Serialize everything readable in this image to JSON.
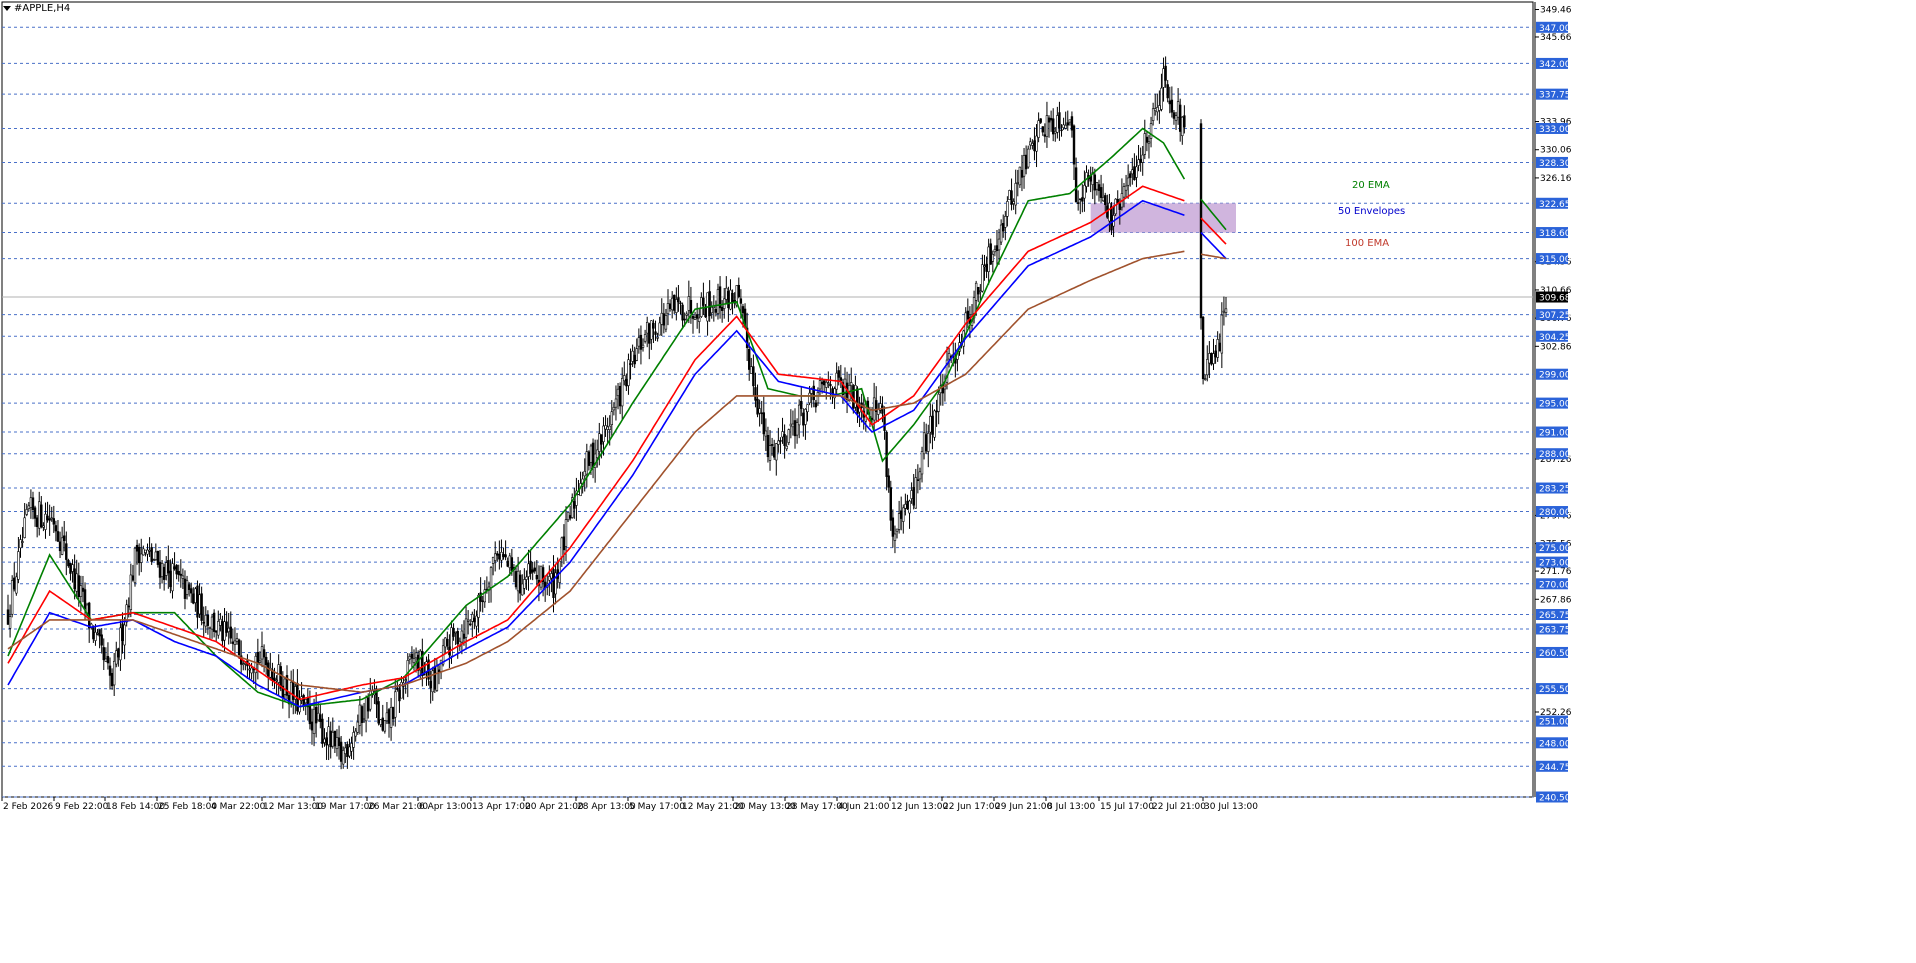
{
  "window": {
    "title": "#APPLE,H4"
  },
  "chart_data": {
    "type": "candlestick",
    "symbol": "#APPLE",
    "timeframe": "H4",
    "current_price": 309.68,
    "ylim": [
      240.5,
      350.5
    ],
    "price_scale_labels": [
      349.46,
      345.66,
      333.96,
      330.06,
      326.16,
      314.56,
      310.66,
      306.76,
      302.86,
      287.26,
      279.46,
      275.56,
      271.76,
      267.86,
      252.26
    ],
    "levels": [
      347.0,
      342.0,
      337.75,
      333.0,
      328.3,
      322.65,
      318.6,
      315.0,
      307.25,
      304.25,
      299.0,
      295.0,
      291.0,
      288.0,
      283.25,
      280.0,
      275.0,
      273.0,
      270.0,
      265.75,
      263.75,
      260.5,
      255.5,
      251.0,
      248.0,
      244.75,
      240.5
    ],
    "level_label_text": [
      "347.00",
      "342.00",
      "337.75",
      "333.00",
      "328.30",
      "322.65",
      "318.60",
      "315.00",
      "307.25",
      "304.25",
      "299.00",
      "295.00",
      "291.00",
      "288.00",
      "283.25",
      "280.00",
      "275.00",
      "273.00",
      "270.00",
      "265.75",
      "263.75",
      "260.50",
      "255.50",
      "251.00",
      "248.00",
      "244.75",
      "240.50"
    ],
    "x_labels": [
      "2 Feb 2026",
      "9 Feb 22:00",
      "18 Feb 14:00",
      "25 Feb 18:00",
      "4 Mar 22:00",
      "12 Mar 13:00",
      "19 Mar 17:00",
      "26 Mar 21:00",
      "6 Apr 13:00",
      "13 Apr 17:00",
      "20 Apr 21:00",
      "28 Apr 13:00",
      "5 May 17:00",
      "12 May 21:00",
      "20 May 13:00",
      "28 May 17:00",
      "4 Jun 21:00",
      "12 Jun 13:00",
      "22 Jun 17:00",
      "29 Jun 21:00",
      "8 Jul 13:00",
      "15 Jul 17:00",
      "22 Jul 21:00",
      "30 Jul 13:00"
    ],
    "anchors": [
      [
        0,
        266
      ],
      [
        10,
        280
      ],
      [
        22,
        279
      ],
      [
        40,
        264
      ],
      [
        50,
        256
      ],
      [
        62,
        275
      ],
      [
        80,
        271
      ],
      [
        100,
        264
      ],
      [
        110,
        261
      ],
      [
        125,
        259
      ],
      [
        135,
        255
      ],
      [
        150,
        250
      ],
      [
        160,
        246
      ],
      [
        175,
        255
      ],
      [
        180,
        249
      ],
      [
        195,
        260
      ],
      [
        205,
        256
      ],
      [
        210,
        261
      ],
      [
        225,
        266
      ],
      [
        235,
        275
      ],
      [
        245,
        270
      ],
      [
        250,
        271
      ],
      [
        262,
        270
      ],
      [
        275,
        285
      ],
      [
        285,
        290
      ],
      [
        305,
        304
      ],
      [
        320,
        308
      ],
      [
        340,
        309
      ],
      [
        350,
        310
      ],
      [
        365,
        288
      ],
      [
        380,
        293
      ],
      [
        395,
        298
      ],
      [
        410,
        295
      ],
      [
        420,
        294
      ],
      [
        425,
        276
      ],
      [
        435,
        282
      ],
      [
        440,
        289
      ],
      [
        452,
        300
      ],
      [
        465,
        310
      ],
      [
        480,
        322
      ],
      [
        495,
        333
      ],
      [
        510,
        335
      ],
      [
        513,
        324
      ],
      [
        520,
        326
      ],
      [
        525,
        325
      ],
      [
        530,
        320
      ],
      [
        545,
        330
      ],
      [
        555,
        340
      ],
      [
        563,
        334
      ],
      [
        570,
        326
      ],
      [
        574,
        299
      ],
      [
        580,
        301
      ],
      [
        585,
        308
      ]
    ],
    "series": [
      {
        "name": "20 EMA",
        "color": "#008000",
        "anchors": [
          [
            0,
            260
          ],
          [
            20,
            274
          ],
          [
            40,
            265
          ],
          [
            60,
            266
          ],
          [
            80,
            266
          ],
          [
            100,
            260
          ],
          [
            120,
            255
          ],
          [
            140,
            253
          ],
          [
            170,
            254
          ],
          [
            190,
            257
          ],
          [
            220,
            267
          ],
          [
            240,
            271
          ],
          [
            270,
            281
          ],
          [
            300,
            295
          ],
          [
            330,
            308
          ],
          [
            350,
            309
          ],
          [
            365,
            297
          ],
          [
            380,
            296
          ],
          [
            395,
            296
          ],
          [
            410,
            297
          ],
          [
            420,
            287
          ],
          [
            435,
            292
          ],
          [
            450,
            298
          ],
          [
            470,
            311
          ],
          [
            490,
            323
          ],
          [
            510,
            324
          ],
          [
            530,
            329
          ],
          [
            545,
            333
          ],
          [
            555,
            331
          ],
          [
            565,
            326
          ],
          [
            585,
            319
          ]
        ]
      },
      {
        "name": "red envelope",
        "color": "#ff0000",
        "anchors": [
          [
            0,
            259
          ],
          [
            20,
            269
          ],
          [
            40,
            265
          ],
          [
            60,
            266
          ],
          [
            80,
            264
          ],
          [
            100,
            262
          ],
          [
            120,
            258
          ],
          [
            140,
            254
          ],
          [
            170,
            256
          ],
          [
            190,
            257
          ],
          [
            220,
            262
          ],
          [
            240,
            265
          ],
          [
            270,
            275
          ],
          [
            300,
            287
          ],
          [
            330,
            301
          ],
          [
            350,
            307
          ],
          [
            370,
            299
          ],
          [
            400,
            298
          ],
          [
            415,
            292
          ],
          [
            435,
            296
          ],
          [
            460,
            306
          ],
          [
            490,
            316
          ],
          [
            520,
            320
          ],
          [
            545,
            325
          ],
          [
            565,
            323
          ],
          [
            585,
            317
          ]
        ]
      },
      {
        "name": "blue envelope",
        "color": "#0000ff",
        "anchors": [
          [
            0,
            256
          ],
          [
            20,
            266
          ],
          [
            40,
            264
          ],
          [
            60,
            265
          ],
          [
            80,
            262
          ],
          [
            100,
            260
          ],
          [
            120,
            256
          ],
          [
            140,
            253
          ],
          [
            170,
            255
          ],
          [
            190,
            256
          ],
          [
            220,
            261
          ],
          [
            240,
            264
          ],
          [
            270,
            273
          ],
          [
            300,
            285
          ],
          [
            330,
            299
          ],
          [
            350,
            305
          ],
          [
            370,
            298
          ],
          [
            400,
            296
          ],
          [
            415,
            291
          ],
          [
            435,
            294
          ],
          [
            460,
            304
          ],
          [
            490,
            314
          ],
          [
            520,
            318
          ],
          [
            545,
            323
          ],
          [
            565,
            321
          ],
          [
            585,
            315
          ]
        ]
      },
      {
        "name": "100 EMA",
        "color": "#a0522d",
        "anchors": [
          [
            0,
            261
          ],
          [
            20,
            265
          ],
          [
            40,
            265
          ],
          [
            60,
            265
          ],
          [
            80,
            263
          ],
          [
            100,
            261
          ],
          [
            120,
            259
          ],
          [
            140,
            256
          ],
          [
            170,
            255
          ],
          [
            190,
            256
          ],
          [
            220,
            259
          ],
          [
            240,
            262
          ],
          [
            270,
            269
          ],
          [
            300,
            280
          ],
          [
            330,
            291
          ],
          [
            350,
            296
          ],
          [
            370,
            296
          ],
          [
            400,
            296
          ],
          [
            415,
            294
          ],
          [
            435,
            295
          ],
          [
            460,
            299
          ],
          [
            490,
            308
          ],
          [
            520,
            312
          ],
          [
            545,
            315
          ],
          [
            565,
            316
          ],
          [
            585,
            315
          ]
        ]
      }
    ],
    "annotations": [
      {
        "text": "20 EMA",
        "color": "#008000"
      },
      {
        "text": "50 Envelopes",
        "color": "#0000cc"
      },
      {
        "text": "100 EMA",
        "color": "#c0392b"
      }
    ],
    "zone": {
      "from": 318.6,
      "to": 322.65,
      "color": "#c8a8d8",
      "start_bar": 520
    },
    "level_line_color": "#4a70c8",
    "label_bg": "#2b63d9",
    "current_price_label_bg": "#000000",
    "bar_color": "#000000"
  }
}
